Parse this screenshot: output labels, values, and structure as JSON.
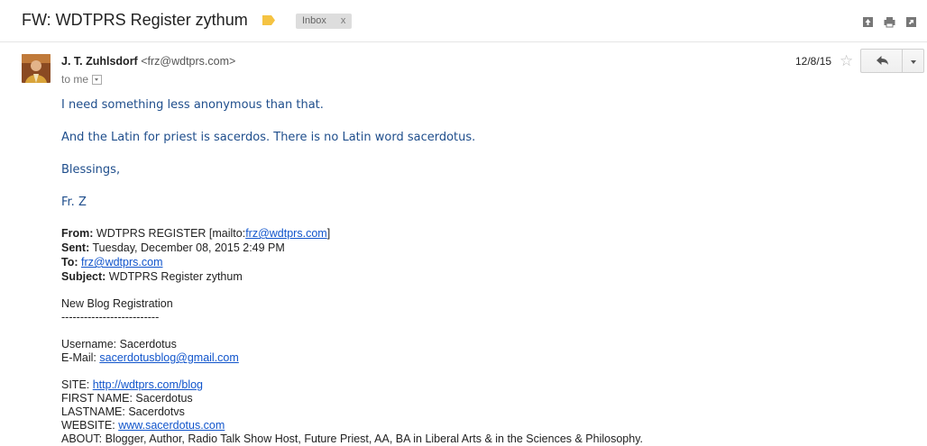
{
  "header": {
    "subject": "FW: WDTPRS Register zythum",
    "label_chip": "Inbox",
    "label_chip_close": "x",
    "icons": [
      "expand-all-icon",
      "print-icon",
      "open-new-window-icon"
    ]
  },
  "message": {
    "sender_name": "J. T. Zuhlsdorf",
    "sender_email": "<frz@wdtprs.com>",
    "to_line": "to me",
    "date": "12/8/15",
    "star": "☆",
    "body": [
      "I need something less anonymous than that.",
      "And the Latin for priest is sacerdos.  There is no Latin word sacerdotus.",
      "Blessings,",
      "Fr. Z"
    ],
    "forward": {
      "from_label": "From:",
      "from_value": "WDTPRS REGISTER [mailto:",
      "from_link": "frz@wdtprs.com",
      "from_close": "]",
      "sent_label": "Sent:",
      "sent_value": "Tuesday, December 08, 2015 2:49 PM",
      "to_label": "To:",
      "to_link": "frz@wdtprs.com",
      "subject_label": "Subject:",
      "subject_value": "WDTPRS Register zythum"
    },
    "registration": {
      "title": "New Blog Registration",
      "divider": "--------------------------",
      "username": "Username: Sacerdotus",
      "email_label": "E-Mail: ",
      "email_link": "sacerdotusblog@gmail.com",
      "site_label": "SITE: ",
      "site_link": "http://wdtprs.com/blog",
      "first_name": "FIRST NAME: Sacerdotus",
      "last_name": "LASTNAME: Sacerdotvs",
      "website_label": "WEBSITE: ",
      "website_link": "www.sacerdotus.com",
      "about": "ABOUT: Blogger, Author, Radio Talk Show Host, Future Priest, AA, BA in Liberal Arts & in the Sciences & Philosophy."
    }
  }
}
